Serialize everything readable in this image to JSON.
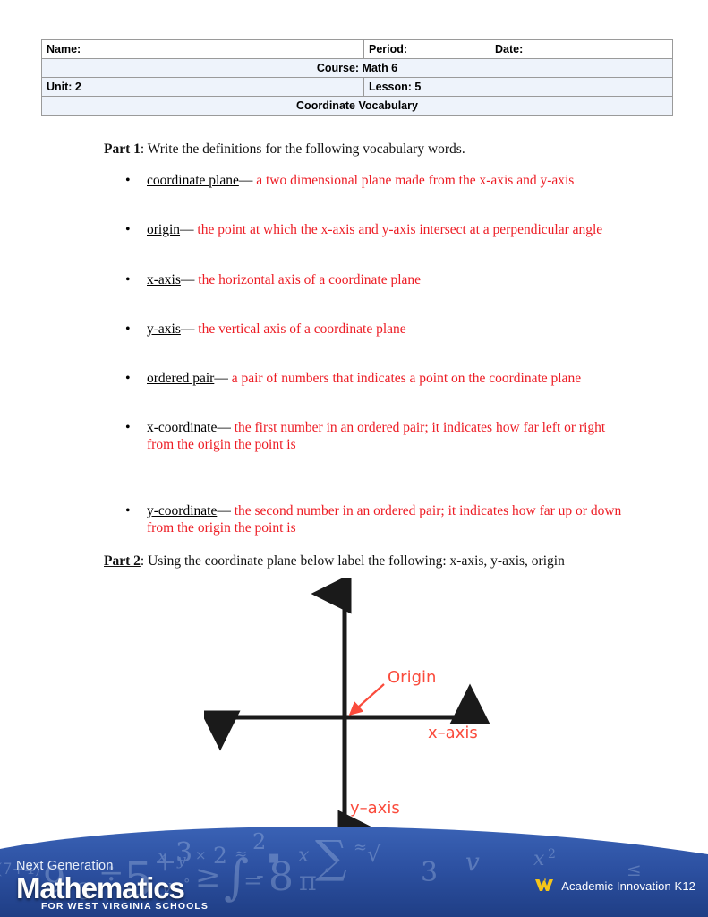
{
  "header_table": {
    "row1": {
      "name_label": "Name:",
      "period_label": "Period:",
      "date_label": "Date:"
    },
    "row2": {
      "course": "Course: Math 6"
    },
    "row3": {
      "unit": "Unit: 2",
      "lesson": "Lesson: 5"
    },
    "row4": {
      "title": "Coordinate Vocabulary"
    }
  },
  "part1": {
    "label": "Part 1",
    "instruction": ": Write the definitions for the following vocabulary words.",
    "items": [
      {
        "term": "coordinate plane",
        "dash": "— ",
        "definition": "a two dimensional plane made from the x-axis and y-axis"
      },
      {
        "term": "origin",
        "dash": "— ",
        "definition": "the point at which the x-axis and y-axis intersect at a perpendicular angle"
      },
      {
        "term": "x-axis",
        "dash": "— ",
        "definition": "the horizontal axis of a coordinate plane"
      },
      {
        "term": "y-axis",
        "dash": "— ",
        "definition": "the vertical axis of a coordinate plane"
      },
      {
        "term": "ordered pair",
        "dash": "— ",
        "definition": "a pair of numbers that indicates a point on the coordinate plane"
      },
      {
        "term": "x-coordinate",
        "dash": "— ",
        "definition": "the first number in an ordered pair; it indicates how far left or right from the origin the point is"
      },
      {
        "term": "y-coordinate",
        "dash": "— ",
        "definition": "the second number in an ordered pair; it indicates how far up or down from the origin the point is"
      }
    ],
    "bullet_glyph": "•"
  },
  "part2": {
    "label": "Part 2",
    "instruction": ": Using the coordinate plane below label the following: x-axis, y-axis, origin"
  },
  "diagram": {
    "origin_label": "Origin",
    "x_axis_label": "x–axis",
    "y_axis_label": "y–axis",
    "axis_color": "#1a1a1a",
    "label_color": "#fa4b3c"
  },
  "footer": {
    "next_generation": "Next Generation",
    "mathematics": "Mathematics",
    "for_wv_schools": "FOR WEST VIRGINIA SCHOOLS",
    "brand_text": "Academic Innovation K12",
    "banner_color": "#2a4f9f",
    "logo_gold": "#f5c518",
    "math_symbols": [
      "x",
      "y",
      "×",
      "2",
      "≈",
      "2",
      "■",
      "x",
      "∑",
      "≈",
      "√",
      "(7+4)",
      "9",
      "°",
      "3",
      "÷",
      "5",
      "y",
      "+",
      "3",
      "°",
      "≥",
      "∫",
      "=",
      "-",
      "8",
      "π",
      "°",
      "x",
      "2"
    ]
  }
}
